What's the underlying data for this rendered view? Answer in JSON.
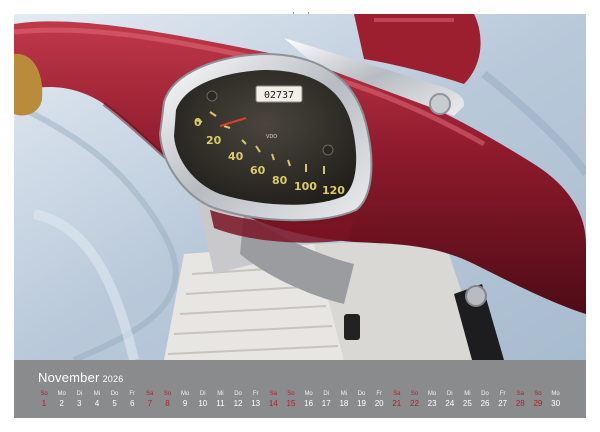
{
  "calendar": {
    "month": "November",
    "year": "2026",
    "days": [
      {
        "dow": "So",
        "num": "1",
        "red": true
      },
      {
        "dow": "Mo",
        "num": "2",
        "red": false
      },
      {
        "dow": "Di",
        "num": "3",
        "red": false
      },
      {
        "dow": "Mi",
        "num": "4",
        "red": false
      },
      {
        "dow": "Do",
        "num": "5",
        "red": false
      },
      {
        "dow": "Fr",
        "num": "6",
        "red": false
      },
      {
        "dow": "Sa",
        "num": "7",
        "red": true
      },
      {
        "dow": "So",
        "num": "8",
        "red": true
      },
      {
        "dow": "Mo",
        "num": "9",
        "red": false
      },
      {
        "dow": "Di",
        "num": "10",
        "red": false
      },
      {
        "dow": "Mi",
        "num": "11",
        "red": false
      },
      {
        "dow": "Do",
        "num": "12",
        "red": false
      },
      {
        "dow": "Fr",
        "num": "13",
        "red": false
      },
      {
        "dow": "Sa",
        "num": "14",
        "red": true
      },
      {
        "dow": "So",
        "num": "15",
        "red": true
      },
      {
        "dow": "Mo",
        "num": "16",
        "red": false
      },
      {
        "dow": "Di",
        "num": "17",
        "red": false
      },
      {
        "dow": "Mi",
        "num": "18",
        "red": false
      },
      {
        "dow": "Do",
        "num": "19",
        "red": false
      },
      {
        "dow": "Fr",
        "num": "20",
        "red": false
      },
      {
        "dow": "Sa",
        "num": "21",
        "red": true
      },
      {
        "dow": "So",
        "num": "22",
        "red": true
      },
      {
        "dow": "Mo",
        "num": "23",
        "red": false
      },
      {
        "dow": "Di",
        "num": "24",
        "red": false
      },
      {
        "dow": "Mi",
        "num": "25",
        "red": false
      },
      {
        "dow": "Do",
        "num": "26",
        "red": false
      },
      {
        "dow": "Fr",
        "num": "27",
        "red": false
      },
      {
        "dow": "Sa",
        "num": "28",
        "red": true
      },
      {
        "dow": "So",
        "num": "29",
        "red": true
      },
      {
        "dow": "Mo",
        "num": "30",
        "red": false
      }
    ]
  },
  "speedometer": {
    "odometer": "02737",
    "scale": [
      "0",
      "20",
      "40",
      "60",
      "80",
      "100",
      "120"
    ],
    "label": "VDO"
  },
  "colors": {
    "bar": "#8a8b8d",
    "weekend": "#b3202c",
    "body_red": "#8e1a2c",
    "cloth": "#c9d6e3"
  }
}
